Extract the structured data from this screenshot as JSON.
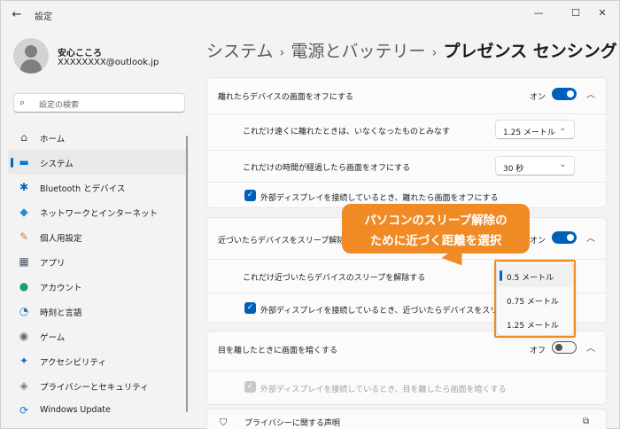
{
  "window": {
    "title": "設定",
    "back_icon": "←",
    "min_icon": "—",
    "max_icon": "☐",
    "close_icon": "✕"
  },
  "user": {
    "name": "安心こころ",
    "email": "XXXXXXXX@outlook.jp"
  },
  "search": {
    "placeholder": "設定の検索",
    "icon": "⌕"
  },
  "nav": [
    {
      "label": "ホーム",
      "icon": "⌂",
      "color": "#555555"
    },
    {
      "label": "システム",
      "icon": "▬",
      "color": "#0078d4",
      "active": true
    },
    {
      "label": "Bluetooth とデバイス",
      "icon": "✱",
      "color": "#0a67c7"
    },
    {
      "label": "ネットワークとインターネット",
      "icon": "◆",
      "color": "#1f89d8"
    },
    {
      "label": "個人用設定",
      "icon": "✎",
      "color": "#e07a2d"
    },
    {
      "label": "アプリ",
      "icon": "▦",
      "color": "#4c5a6a"
    },
    {
      "label": "アカウント",
      "icon": "●",
      "color": "#1c9e6e"
    },
    {
      "label": "時刻と言語",
      "icon": "◔",
      "color": "#1f7bd2"
    },
    {
      "label": "ゲーム",
      "icon": "◉",
      "color": "#6a6a6a"
    },
    {
      "label": "アクセシビリティ",
      "icon": "✦",
      "color": "#1a6fc9"
    },
    {
      "label": "プライバシーとセキュリティ",
      "icon": "◈",
      "color": "#7a7a7a"
    },
    {
      "label": "Windows Update",
      "icon": "⟳",
      "color": "#1f7bd2"
    }
  ],
  "breadcrumb": {
    "part1": "システム",
    "part2": "電源とバッテリー",
    "part3": "プレゼンス センシング",
    "sep": "›"
  },
  "section1": {
    "title": "離れたらデバイスの画面をオフにする",
    "toggle_label": "オン",
    "toggle_state": "on",
    "row1_label": "これだけ遠くに離れたときは、いなくなったものとみなす",
    "row1_value": "1.25 メートル",
    "row2_label": "これだけの時間が経過したら画面をオフにする",
    "row2_value": "30 秒",
    "row3_label": "外部ディスプレイを接続しているとき、離れたら画面をオフにする",
    "row3_checked": true
  },
  "section2": {
    "title": "近づいたらデバイスをスリープ解除する",
    "toggle_label": "オン",
    "toggle_state": "on",
    "row1_label": "これだけ近づいたらデバイスのスリープを解除する",
    "row2_label": "外部ディスプレイを接続しているとき、近づいたらデバイスをスリープ解除",
    "row2_checked": true
  },
  "dropdown": {
    "options": [
      "0.5 メートル",
      "0.75 メートル",
      "1.25 メートル"
    ],
    "selected_index": 0
  },
  "section3": {
    "title": "目を離したときに画面を暗くする",
    "toggle_label": "オフ",
    "toggle_state": "off",
    "row1_label": "外部ディスプレイを接続しているとき、目を離したら画面を暗くする",
    "row1_checked": true,
    "row1_disabled": true
  },
  "privacy": {
    "label": "プライバシーに関する声明"
  },
  "callout": {
    "line1": "パソコンのスリープ解除の",
    "line2": "ために近づく距離を選択"
  },
  "colors": {
    "accent": "#005fb8",
    "callout": "#f08a24"
  },
  "chevron_up": "︿",
  "chevron_down": "⌄",
  "check": "✓"
}
